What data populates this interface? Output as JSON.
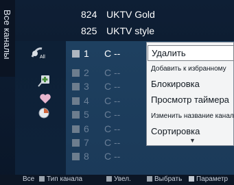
{
  "top_channels": [
    {
      "number": "824",
      "name": "UKTV Gold"
    },
    {
      "number": "825",
      "name": "UKTV style"
    }
  ],
  "side_title": "Все каналы",
  "channels": [
    {
      "number": "1",
      "name": "C --"
    },
    {
      "number": "2",
      "name": "C --"
    },
    {
      "number": "3",
      "name": "C --"
    },
    {
      "number": "4",
      "name": "C --"
    },
    {
      "number": "5",
      "name": "C --"
    },
    {
      "number": "6",
      "name": "C --"
    },
    {
      "number": "7",
      "name": "C --"
    },
    {
      "number": "8",
      "name": "C --"
    }
  ],
  "icons": [
    "all-channels-icon",
    "add-favorite-icon",
    "heart-icon",
    "clock-icon"
  ],
  "icon_label_all": "All",
  "context_menu": [
    {
      "label": "Удалить"
    },
    {
      "label": "Добавить к избранному"
    },
    {
      "label": "Блокировка"
    },
    {
      "label": "Просмотр таймера"
    },
    {
      "label": "Изменить название канала"
    },
    {
      "label": "Сортировка"
    }
  ],
  "context_menu_more": "▼",
  "bottom_bar": {
    "all": "Все",
    "type": "Тип канала",
    "zoom": "Увел.",
    "select": "Выбрать",
    "params": "Параметр"
  },
  "colors": {
    "panel": "#1e4060",
    "menu": "#f3f4f5",
    "accent_text": "#ffffff"
  }
}
